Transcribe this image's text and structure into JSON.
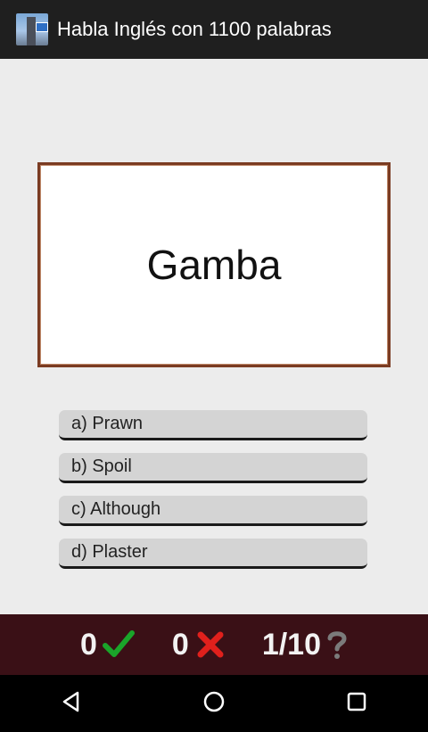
{
  "app": {
    "title": "Habla Inglés con 1100 palabras",
    "icon": "app-icon-big-ben"
  },
  "question": {
    "word": "Gamba"
  },
  "answers": [
    {
      "label": "a) Prawn"
    },
    {
      "label": "b) Spoil"
    },
    {
      "label": "c) Although"
    },
    {
      "label": "d) Plaster"
    }
  ],
  "score": {
    "correct": "0",
    "wrong": "0",
    "progress": "1/10",
    "correct_icon": "check-icon",
    "wrong_icon": "cross-icon",
    "progress_icon": "question-icon",
    "colors": {
      "correct": "#1aa52a",
      "wrong": "#e0201c",
      "help": "#7b7b7b"
    }
  },
  "nav": {
    "back_icon": "back-icon",
    "home_icon": "home-icon",
    "recents_icon": "recents-icon"
  }
}
